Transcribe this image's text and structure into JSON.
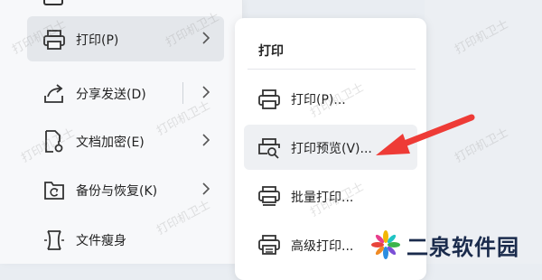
{
  "main_menu": {
    "items": [
      {
        "label": "打印(P)",
        "icon": "printer-icon",
        "has_submenu": true,
        "selected": true
      },
      {
        "label": "分享发送(D)",
        "icon": "share-icon",
        "has_submenu": true
      },
      {
        "label": "文档加密(E)",
        "icon": "document-lock-icon",
        "has_submenu": true
      },
      {
        "label": "备份与恢复(K)",
        "icon": "backup-restore-icon",
        "has_submenu": true
      },
      {
        "label": "文件瘦身",
        "icon": "file-slim-icon",
        "has_submenu": false
      }
    ]
  },
  "submenu": {
    "title": "打印",
    "items": [
      {
        "label": "打印(P)...",
        "icon": "printer-icon"
      },
      {
        "label": "打印预览(V)...",
        "icon": "print-preview-icon",
        "highlighted": true
      },
      {
        "label": "批量打印...",
        "icon": "batch-print-icon"
      },
      {
        "label": "高级打印...",
        "icon": "advanced-print-icon"
      }
    ]
  },
  "watermark": "打印机卫士",
  "logo": {
    "text": "二泉软件园"
  },
  "colors": {
    "annotation_arrow": "#ee3b36",
    "selected_bg": "#e4e7eb",
    "hover_bg": "#eef0f3"
  }
}
